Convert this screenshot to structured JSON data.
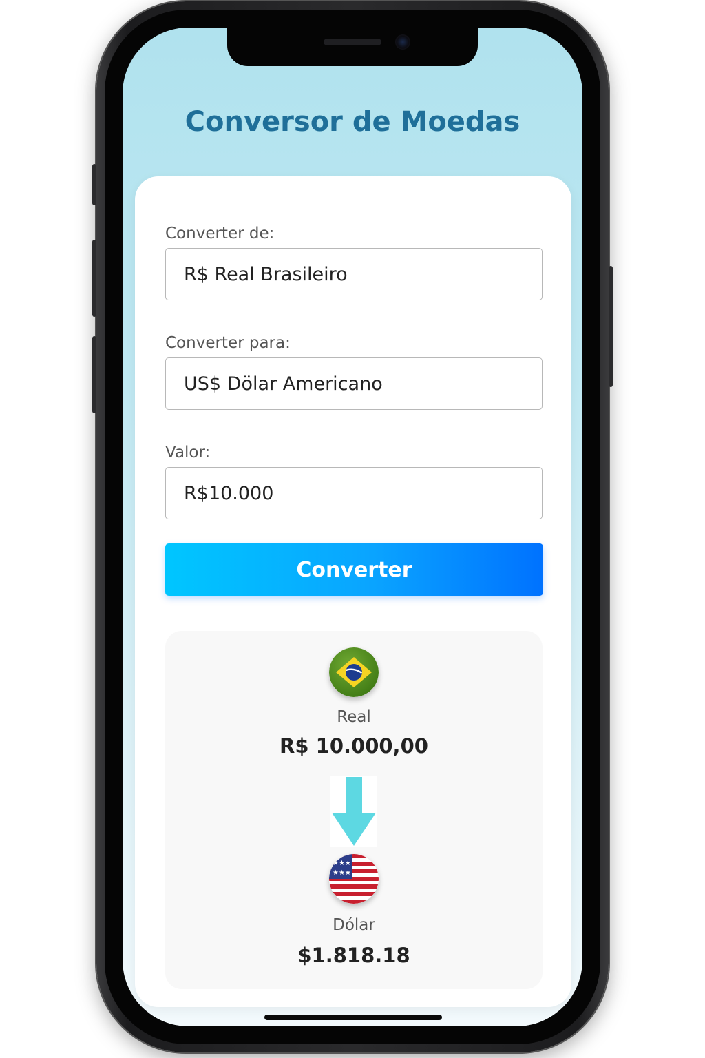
{
  "app": {
    "title": "Conversor de Moedas"
  },
  "form": {
    "from_label": "Converter de:",
    "from_value": "R$ Real Brasileiro",
    "to_label": "Converter para:",
    "to_value": "US$ Dölar Americano",
    "amount_label": "Valor:",
    "amount_value": "R$10.000",
    "convert_button": "Converter"
  },
  "result": {
    "source": {
      "flag_icon": "brazil-flag-icon",
      "name": "Real",
      "amount": "R$ 10.000,00"
    },
    "arrow_icon": "arrow-down-icon",
    "target": {
      "flag_icon": "usa-flag-icon",
      "name": "Dólar",
      "amount": "$1.818.18"
    }
  },
  "colors": {
    "title": "#1f6f99",
    "button_gradient_start": "#00c6ff",
    "button_gradient_end": "#0072ff",
    "arrow": "#5dd8e2",
    "background_top": "#b0e2ee"
  }
}
